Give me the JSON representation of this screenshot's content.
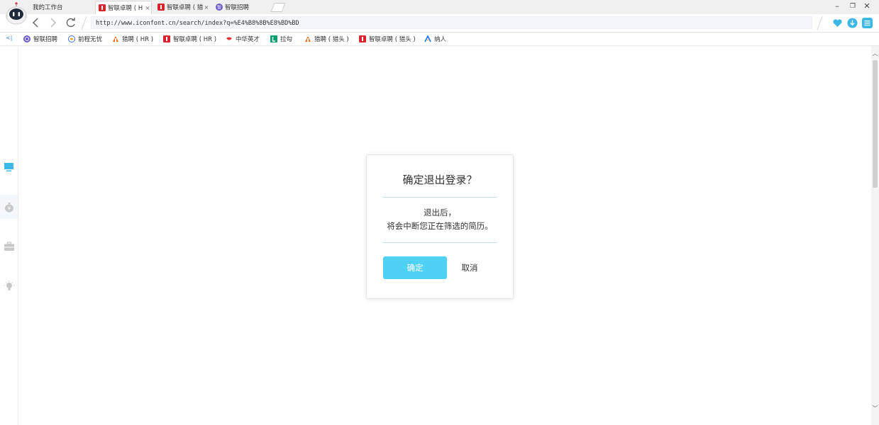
{
  "tabs": [
    {
      "title": "我的工作台",
      "closable": false
    },
    {
      "title": "智联卓聘 ( H",
      "closable": true
    },
    {
      "title": "智联卓聘 ( 猎",
      "closable": true
    },
    {
      "title": "智联招聘",
      "closable": false
    }
  ],
  "window_controls": [
    "minimize",
    "restore",
    "close"
  ],
  "nav": {
    "back": "chevron-left-icon",
    "forward": "chevron-right-icon",
    "reload": "reload-icon"
  },
  "address": {
    "url": "http://www.iconfont.cn/search/index?q=%E4%B8%8B%E8%BD%BD"
  },
  "toolbar_right": [
    "heart-icon",
    "download-icon",
    "menu-icon"
  ],
  "bookmarks": {
    "toggle": "<|",
    "items": [
      {
        "label": "智联招聘",
        "icon": "zhilian-logo-icon"
      },
      {
        "label": "前程无忧",
        "icon": "51job-logo-icon"
      },
      {
        "label": "猎聘 ( HR )",
        "icon": "liepin-logo-icon"
      },
      {
        "label": "智联卓聘 ( HR )",
        "icon": "zhuopin-logo-icon"
      },
      {
        "label": "中华英才",
        "icon": "chinahr-logo-icon"
      },
      {
        "label": "拉勾",
        "icon": "lagou-logo-icon"
      },
      {
        "label": "猎聘 ( 猎头 )",
        "icon": "liepin-logo-icon"
      },
      {
        "label": "智联卓聘 ( 猎头 )",
        "icon": "zhuopin-logo-icon"
      },
      {
        "label": "纳人",
        "icon": "naren-logo-icon"
      }
    ]
  },
  "sidebar": [
    "monitor-icon",
    "money-bag-icon",
    "briefcase-icon",
    "lightbulb-icon"
  ],
  "dialog": {
    "title": "确定退出登录？",
    "message_line1": "退出后，",
    "message_line2": "将会中断您正在筛选的简历。",
    "confirm_label": "确定",
    "cancel_label": "取消"
  },
  "colors": {
    "accent": "#4fd1f5",
    "browser_blue": "#3bb8e6",
    "tab_red": "#d9232d"
  }
}
